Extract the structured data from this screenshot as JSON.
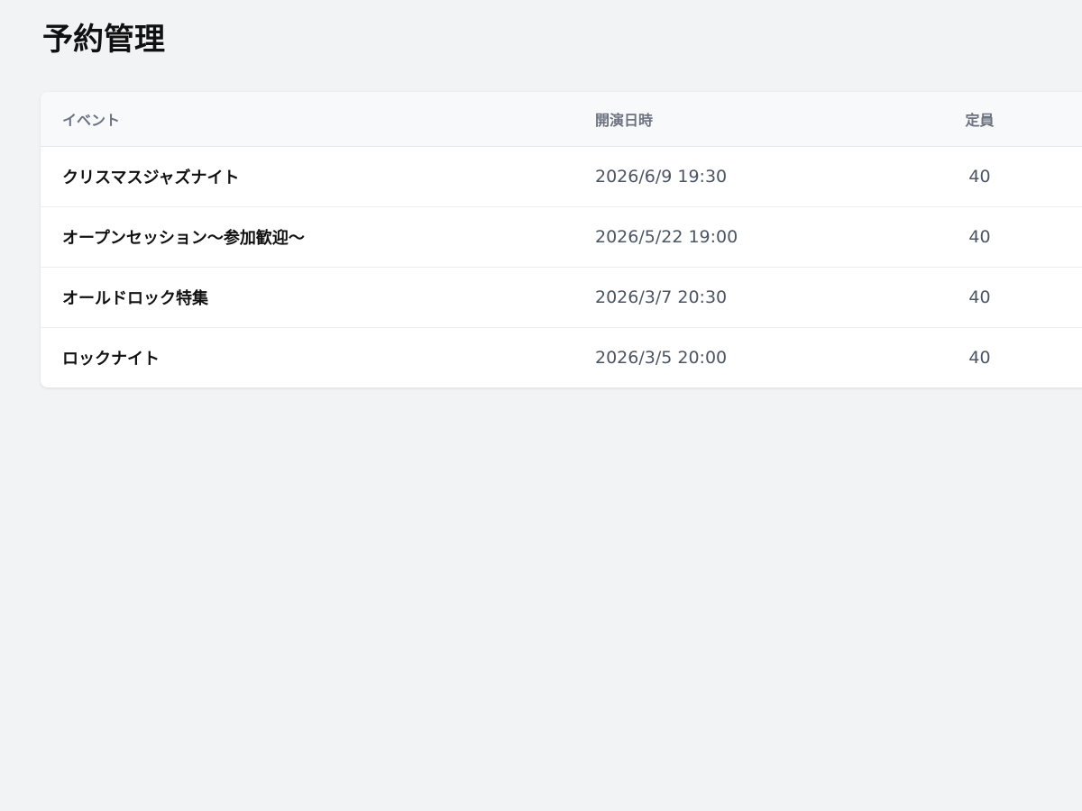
{
  "page": {
    "title": "予約管理"
  },
  "table": {
    "headers": {
      "event": "イベント",
      "datetime": "開演日時",
      "capacity": "定員"
    },
    "rows": [
      {
        "event": "クリスマスジャズナイト",
        "datetime": "2026/6/9 19:30",
        "capacity": "40"
      },
      {
        "event": "オープンセッション～参加歓迎～",
        "datetime": "2026/5/22 19:00",
        "capacity": "40"
      },
      {
        "event": "オールドロック特集",
        "datetime": "2026/3/7 20:30",
        "capacity": "40"
      },
      {
        "event": "ロックナイト",
        "datetime": "2026/3/5 20:00",
        "capacity": "40"
      }
    ]
  },
  "colors": {
    "background": "#f2f3f5",
    "card": "#ffffff",
    "header_bg": "#f8f9fb",
    "header_text": "#6b7280",
    "primary_text": "#111111",
    "secondary_text": "#4b5563"
  }
}
